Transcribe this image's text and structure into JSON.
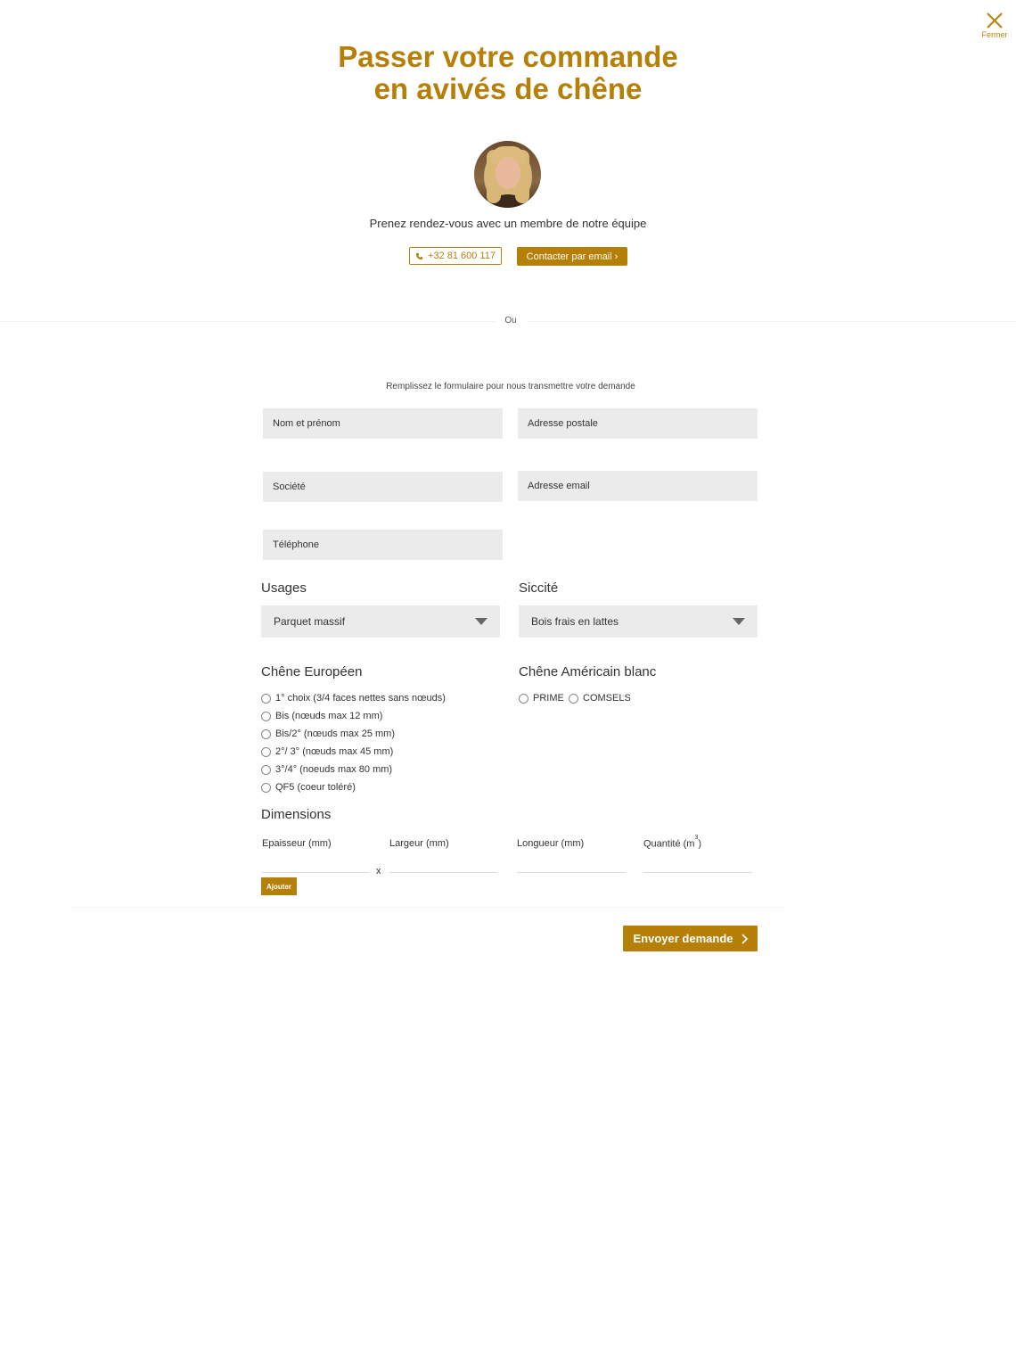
{
  "header": {
    "close_label": "Fermer",
    "title_line1": "Passer votre commande",
    "title_line2": "en avivés de chêne"
  },
  "contact": {
    "tagline": "Prenez rendez-vous avec un membre de notre équipe",
    "phone": "+32 81 600 117",
    "email_button": "Contacter par email",
    "separator": "Ou"
  },
  "form": {
    "intro": "Remplissez le formulaire pour nous transmettre votre demande",
    "fields": {
      "name": "Nom et prénom",
      "address": "Adresse postale",
      "company": "Société",
      "email": "Adresse email",
      "phone": "Téléphone"
    },
    "usages": {
      "label": "Usages",
      "selected": "Parquet massif"
    },
    "siccite": {
      "label": "Siccité",
      "selected": "Bois frais en lattes"
    },
    "chene_europeen": {
      "label": "Chêne Européen",
      "options": [
        "1° choix (3/4 faces nettes sans nœuds)",
        "Bis (nœuds max 12 mm)",
        "Bis/2° (nœuds max 25 mm)",
        "2°/ 3° (nœuds max 45 mm)",
        "3°/4° (noeuds max 80 mm)",
        "QF5 (coeur toléré)"
      ]
    },
    "chene_americain": {
      "label": "Chêne Américain blanc",
      "options": [
        "PRIME",
        "COMSELS"
      ]
    },
    "dimensions": {
      "label": "Dimensions",
      "epaisseur": "Epaisseur (mm)",
      "largeur": "Largeur (mm)",
      "longueur": "Longueur (mm)",
      "quantite_prefix": "Quantité (m",
      "quantite_exp": "3",
      "quantite_suffix": ")",
      "times": "x",
      "add_button": "Ajouter"
    },
    "submit": "Envoyer demande"
  },
  "colors": {
    "accent": "#b57f08",
    "field_bg": "#ebebeb"
  }
}
